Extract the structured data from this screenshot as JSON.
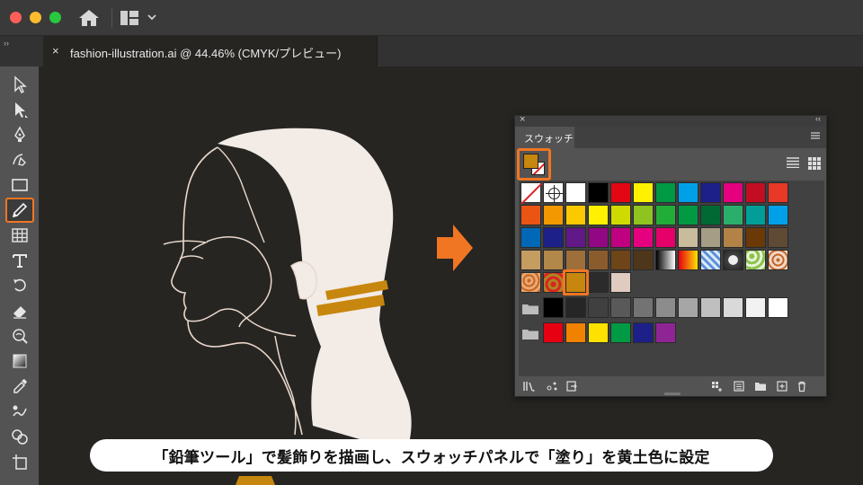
{
  "window": {
    "tab_close": "×",
    "document_title": "fashion-illustration.ai @ 44.46% (CMYK/プレビュー)",
    "panel_toggle": "››"
  },
  "toolbar": {
    "tools": [
      {
        "name": "selection-tool",
        "icon": "selection-arrow-icon"
      },
      {
        "name": "direct-selection-tool",
        "icon": "direct-selection-icon"
      },
      {
        "name": "pen-tool",
        "icon": "pen-icon"
      },
      {
        "name": "curvature-tool",
        "icon": "curvature-icon"
      },
      {
        "name": "rectangle-tool",
        "icon": "rectangle-icon"
      },
      {
        "name": "pencil-tool",
        "icon": "pencil-icon",
        "active": true
      },
      {
        "name": "grid-tool",
        "icon": "grid-icon"
      },
      {
        "name": "type-tool",
        "icon": "type-icon"
      },
      {
        "name": "rotate-tool",
        "icon": "rotate-icon"
      },
      {
        "name": "eraser-tool",
        "icon": "eraser-icon"
      },
      {
        "name": "warp-tool",
        "icon": "warp-icon"
      },
      {
        "name": "gradient-tool",
        "icon": "gradient-icon"
      },
      {
        "name": "eyedropper-tool",
        "icon": "eyedropper-icon"
      },
      {
        "name": "puppet-warp-tool",
        "icon": "puppet-warp-icon"
      },
      {
        "name": "shape-builder-tool",
        "icon": "shape-builder-icon"
      },
      {
        "name": "artboard-tool",
        "icon": "artboard-icon"
      }
    ],
    "accent": "#f07623"
  },
  "swatches_panel": {
    "close": "×",
    "collapse": "‹‹",
    "tab_label": "スウォッチ",
    "fill_color": "#c7860e",
    "selected_swatch": "#c7860e",
    "rows": [
      [
        "none",
        "registration",
        "#ffffff",
        "#000000",
        "#e30613",
        "#fff100",
        "#009944",
        "#00a0e9",
        "#1d2088",
        "#e4007f",
        "#c30d23",
        "#e83828"
      ],
      [
        "#ea5514",
        "#f39800",
        "#fcc800",
        "#fff100",
        "#cfdb00",
        "#8fc31f",
        "#22ac38",
        "#009944",
        "#006934",
        "#2bae6b",
        "#009e96",
        "#00a0e9"
      ],
      [
        "#0068b7",
        "#1d2088",
        "#601986",
        "#920783",
        "#be0081",
        "#e4007f",
        "#e5006a",
        "#c9bc9c",
        "#a69d86",
        "#b28247",
        "#6a3906",
        "#5f4a36"
      ],
      [
        "#c59d61",
        "#b1874a",
        "#9e6f3b",
        "#8a5c2d",
        "#6e4518",
        "#4e361a",
        "gradient-bw",
        "gradient-orange",
        "gradient-blue",
        "pattern-dots",
        "pattern-green",
        "pattern-paisley"
      ],
      [
        "pattern-flower",
        "pattern-flower-red",
        "#c7860e",
        "#2b2b2b",
        "#e0cbc0"
      ]
    ],
    "gray_group": [
      "#000000",
      "#262626",
      "#404040",
      "#595959",
      "#737373",
      "#8c8c8c",
      "#a6a6a6",
      "#bfbfbf",
      "#d9d9d9",
      "#f2f2f2",
      "#ffffff"
    ],
    "bright_group": [
      "#e60012",
      "#f08200",
      "#ffe100",
      "#009944",
      "#1d2088",
      "#8f2594"
    ],
    "bottom_icons": [
      "library-icon",
      "show-kinds-icon",
      "swatch-options-icon",
      "color-group-icon",
      "new-swatch-group-icon",
      "folder-icon",
      "new-swatch-icon",
      "trash-icon"
    ]
  },
  "caption": {
    "text": "「鉛筆ツール」で髪飾りを描画し、スウォッチパネルで「塗り」を黄土色に設定"
  },
  "artwork": {
    "hair_color": "#f2ebe6",
    "line_color": "#e9d8cc",
    "accessory_color": "#c7860e",
    "arrow_color": "#f07623"
  }
}
